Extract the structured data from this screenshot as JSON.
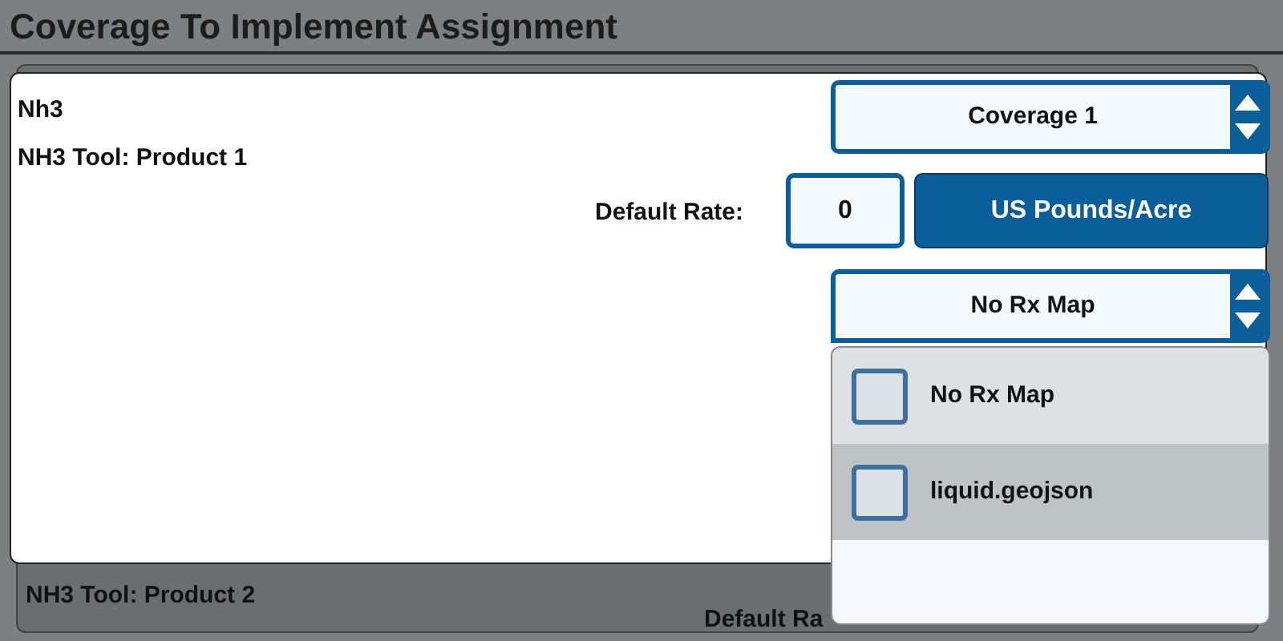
{
  "title": "Coverage To Implement Assignment",
  "background_panel": {
    "tool": "NH3 Tool: Product 2",
    "rate_label": "Default Ra"
  },
  "card": {
    "product": "Nh3",
    "tool": "NH3 Tool: Product 1",
    "coverage": {
      "value": "Coverage 1"
    },
    "rate_label": "Default Rate:",
    "rate": "0",
    "units_button": "US Pounds/Acre",
    "rx_map": {
      "value": "No Rx Map",
      "expanded": true
    }
  },
  "dropdown": [
    {
      "label": "No Rx Map",
      "checked": false,
      "selected": false
    },
    {
      "label": "liquid.geojson",
      "checked": false,
      "selected": true
    }
  ]
}
